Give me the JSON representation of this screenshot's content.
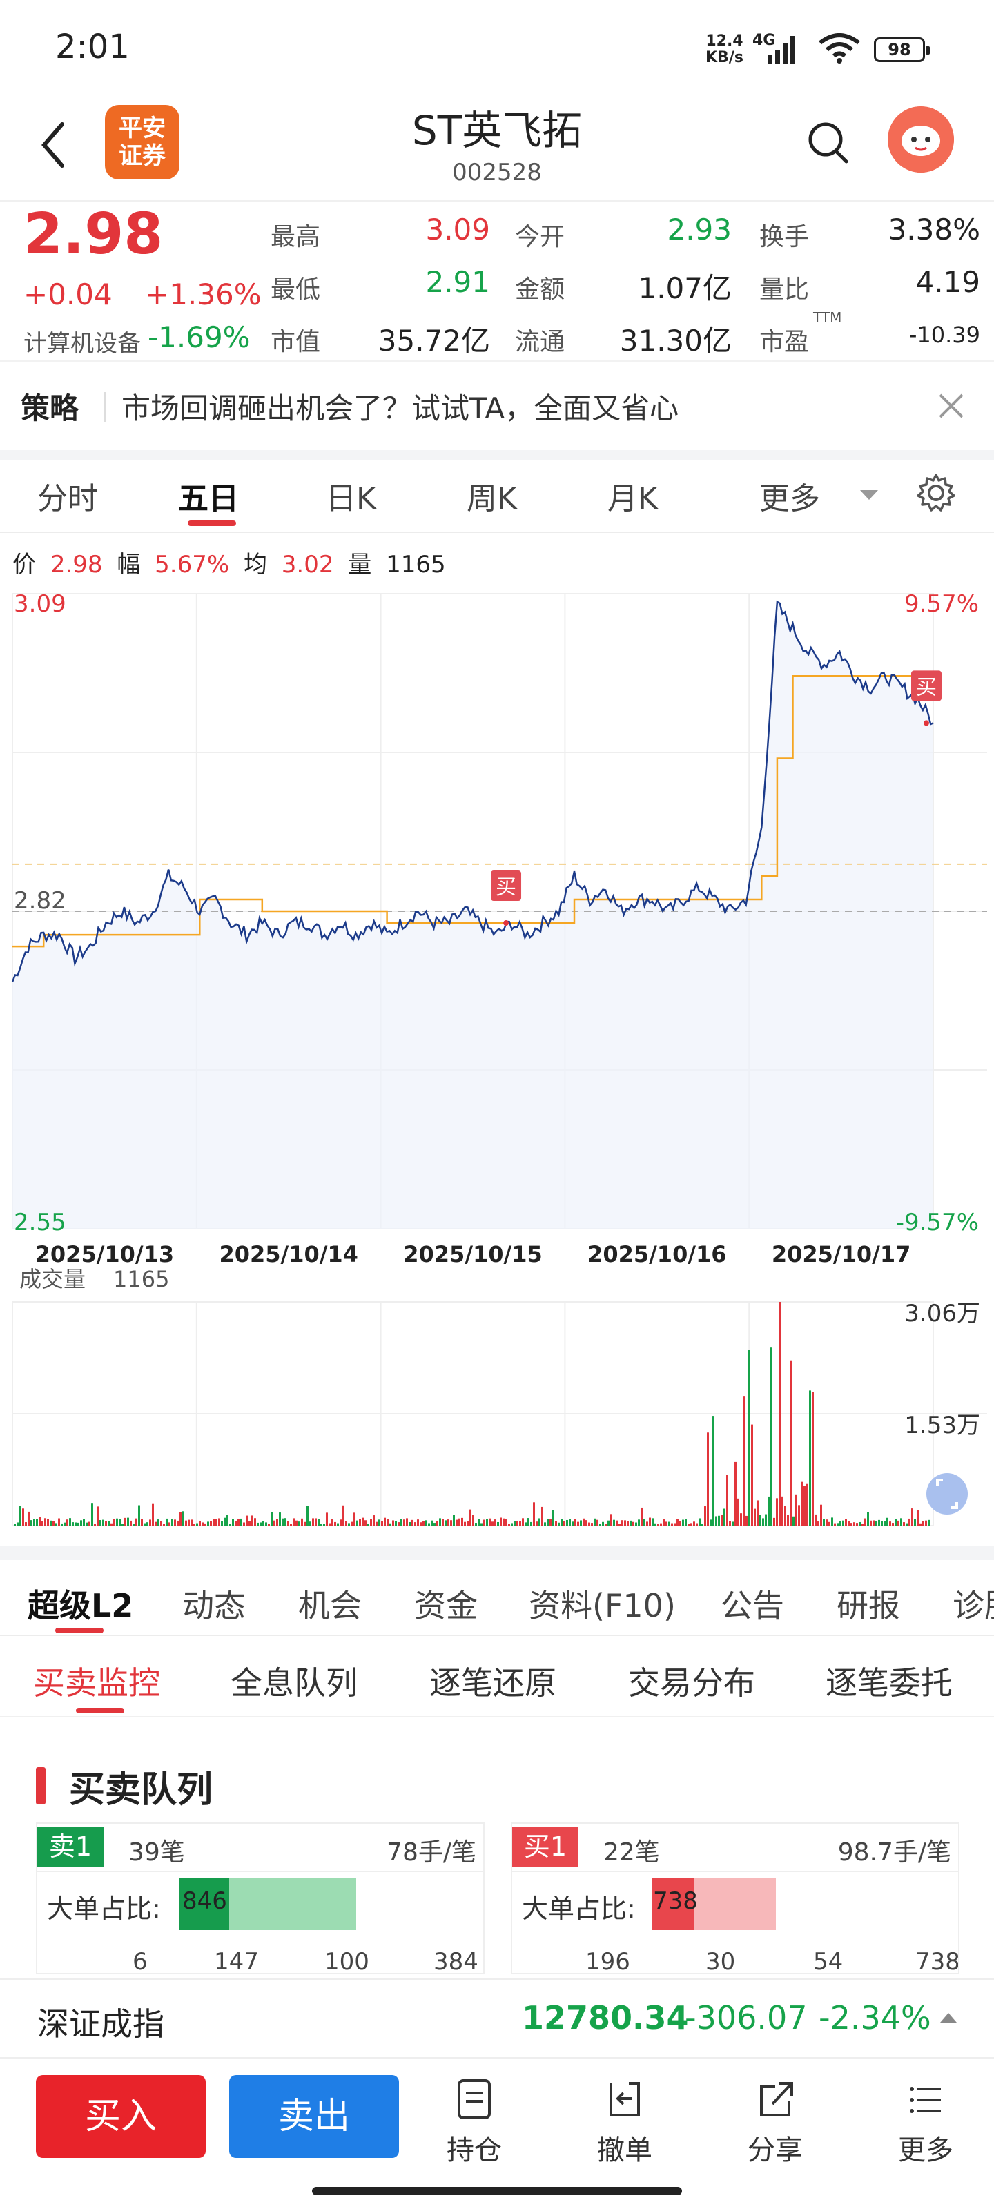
{
  "status_bar": {
    "time": "2:01",
    "net_speed_value": "12.4",
    "net_speed_unit": "KB/s",
    "network": "4G",
    "battery": "98"
  },
  "header": {
    "broker_logo_line1": "平安",
    "broker_logo_line2": "证券",
    "title": "ST英飞拓",
    "code": "002528"
  },
  "quote": {
    "price": "2.98",
    "change": "+0.04",
    "change_pct": "+1.36%",
    "sector_label": "计算机设备",
    "sector_change": "-1.69%",
    "stats": [
      {
        "label": "最高",
        "value": "3.09",
        "color": "red"
      },
      {
        "label": "今开",
        "value": "2.93",
        "color": "green"
      },
      {
        "label": "换手",
        "value": "3.38%",
        "color": "black"
      },
      {
        "label": "最低",
        "value": "2.91",
        "color": "green"
      },
      {
        "label": "金额",
        "value": "1.07亿",
        "color": "black"
      },
      {
        "label": "量比",
        "value": "4.19",
        "color": "black"
      },
      {
        "label": "市值",
        "value": "35.72亿",
        "color": "black"
      },
      {
        "label": "流通",
        "value": "31.30亿",
        "color": "black"
      },
      {
        "label": "市盈",
        "value": "-10.39",
        "color": "black",
        "superscript": "TTM"
      }
    ]
  },
  "strategy": {
    "label": "策略",
    "text": "市场回调砸出机会了？试试TA，全面又省心"
  },
  "chart_tabs": {
    "items": [
      "分时",
      "五日",
      "日K",
      "周K",
      "月K",
      "更多"
    ],
    "active": "五日"
  },
  "info_row": {
    "price_label": "价",
    "price": "2.98",
    "amp_label": "幅",
    "amp": "5.67%",
    "avg_label": "均",
    "avg": "3.02",
    "vol_label": "量",
    "vol": "1165"
  },
  "chart_data": [
    {
      "type": "line",
      "x": [
        "2025/10/13",
        "2025/10/14",
        "2025/10/15",
        "2025/10/16",
        "2025/10/17"
      ],
      "series": [],
      "price_samples": [
        2.76,
        2.79,
        2.8,
        2.8,
        2.78,
        2.79,
        2.81,
        2.82,
        2.81,
        2.82,
        2.85,
        2.84,
        2.82,
        2.83,
        2.81,
        2.8,
        2.81,
        2.8,
        2.81,
        2.81,
        2.8,
        2.81,
        2.8,
        2.81,
        2.8,
        2.81,
        2.82,
        2.81,
        2.81,
        2.82,
        2.81,
        2.8,
        2.81,
        2.8,
        2.81,
        2.82,
        2.85,
        2.83,
        2.84,
        2.82,
        2.83,
        2.83,
        2.82,
        2.83,
        2.84,
        2.83,
        2.82,
        2.83,
        2.89,
        3.08,
        3.06,
        3.04,
        3.03,
        3.04,
        3.02,
        3.01,
        3.02,
        3.01,
        3.0,
        2.98
      ],
      "avg_samples": [
        2.79,
        2.79,
        2.8,
        2.8,
        2.8,
        2.8,
        2.8,
        2.8,
        2.8,
        2.8,
        2.8,
        2.8,
        2.83,
        2.83,
        2.83,
        2.83,
        2.82,
        2.82,
        2.82,
        2.82,
        2.82,
        2.82,
        2.82,
        2.82,
        2.81,
        2.81,
        2.81,
        2.81,
        2.81,
        2.81,
        2.81,
        2.81,
        2.81,
        2.81,
        2.81,
        2.81,
        2.83,
        2.83,
        2.83,
        2.83,
        2.83,
        2.83,
        2.83,
        2.83,
        2.83,
        2.83,
        2.83,
        2.83,
        2.85,
        2.95,
        3.02,
        3.02,
        3.02,
        3.02,
        3.02,
        3.02,
        3.02,
        3.02,
        3.02,
        3.02
      ],
      "ylim": [
        2.55,
        3.09
      ],
      "y_labels": {
        "top": "3.09",
        "bottom": "2.55",
        "ref": "2.82",
        "top_pct": "9.57%",
        "bottom_pct": "-9.57%"
      },
      "ref_price": 2.82,
      "markers": [
        {
          "label": "买",
          "day": 2,
          "position": "late"
        },
        {
          "label": "买",
          "day": 4,
          "position": "end"
        }
      ],
      "grid": true,
      "colors": {
        "price": "#1c3b8a",
        "avg": "#f5a623",
        "up": "#e2353b",
        "down": "#16a34a"
      }
    },
    {
      "type": "bar",
      "title": "成交量",
      "current_value": "1165",
      "y_labels": [
        "3.06万",
        "1.53万"
      ],
      "ylim": [
        0,
        30600
      ],
      "grid": true
    }
  ],
  "l2_tabs": {
    "items": [
      "超级L2",
      "动态",
      "机会",
      "资金",
      "资料(F10)",
      "公告",
      "研报",
      "诊股"
    ],
    "active": "超级L2"
  },
  "sub_tabs": {
    "items": [
      "买卖监控",
      "全息队列",
      "逐笔还原",
      "交易分布",
      "逐笔委托"
    ],
    "active": "买卖监控"
  },
  "queue": {
    "title": "买卖队列",
    "sell": {
      "tag": "卖1",
      "count": "39笔",
      "per": "78手/笔",
      "big_label": "大单占比:",
      "big_value": "846",
      "nums": [
        "6",
        "147",
        "100",
        "384"
      ]
    },
    "buy": {
      "tag": "买1",
      "count": "22笔",
      "per": "98.7手/笔",
      "big_label": "大单占比:",
      "big_value": "738",
      "nums": [
        "196",
        "30",
        "54",
        "738"
      ]
    }
  },
  "index_bar": {
    "name": "深证成指",
    "value": "12780.34",
    "change": "-306.07",
    "pct": "-2.34%"
  },
  "bottom_bar": {
    "buy": "买入",
    "sell": "卖出",
    "hold": "持仓",
    "cancel": "撤单",
    "share": "分享",
    "more": "更多"
  }
}
